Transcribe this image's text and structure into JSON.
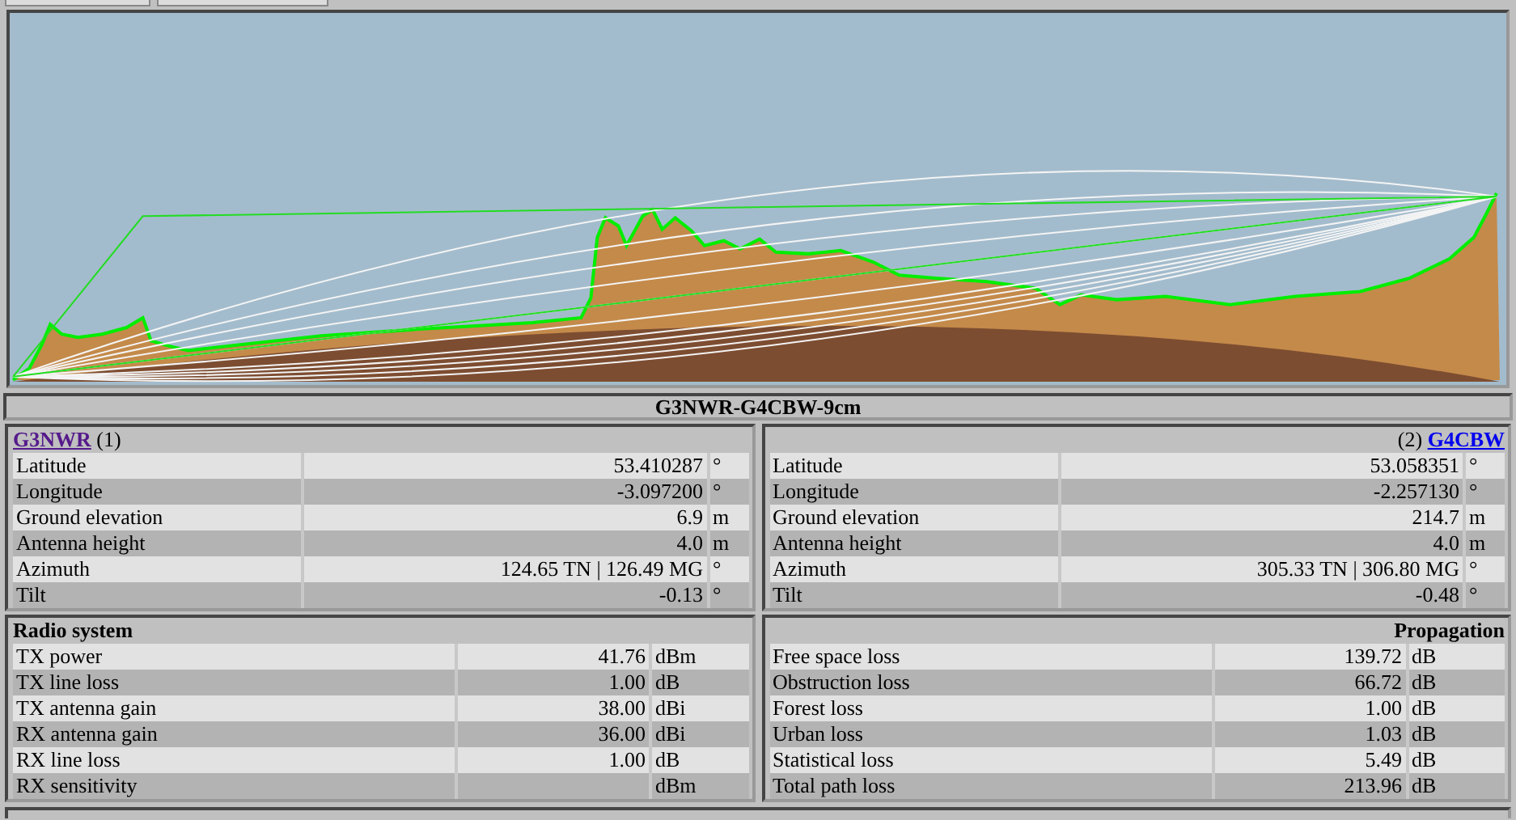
{
  "profile": {
    "title": "G3NWR-G4CBW-9cm"
  },
  "sites": [
    {
      "name": "G3NWR",
      "number": "(1)",
      "visited": true,
      "rows": [
        {
          "label": "Latitude",
          "value": "53.410287",
          "unit": "°"
        },
        {
          "label": "Longitude",
          "value": "-3.097200",
          "unit": "°"
        },
        {
          "label": "Ground elevation",
          "value": "6.9",
          "unit": "m"
        },
        {
          "label": "Antenna height",
          "value": "4.0",
          "unit": "m"
        },
        {
          "label": "Azimuth",
          "value": "124.65 TN | 126.49 MG",
          "unit": "°"
        },
        {
          "label": "Tilt",
          "value": "-0.13",
          "unit": "°"
        }
      ]
    },
    {
      "name": "G4CBW",
      "number": "(2)",
      "visited": false,
      "rows": [
        {
          "label": "Latitude",
          "value": "53.058351",
          "unit": "°"
        },
        {
          "label": "Longitude",
          "value": "-2.257130",
          "unit": "°"
        },
        {
          "label": "Ground elevation",
          "value": "214.7",
          "unit": "m"
        },
        {
          "label": "Antenna height",
          "value": "4.0",
          "unit": "m"
        },
        {
          "label": "Azimuth",
          "value": "305.33 TN | 306.80 MG",
          "unit": "°"
        },
        {
          "label": "Tilt",
          "value": "-0.48",
          "unit": "°"
        }
      ]
    }
  ],
  "panels": [
    {
      "title": "Radio system",
      "rows": [
        {
          "label": "TX power",
          "value": "41.76",
          "unit": "dBm"
        },
        {
          "label": "TX line loss",
          "value": "1.00",
          "unit": "dB"
        },
        {
          "label": "TX antenna gain",
          "value": "38.00",
          "unit": "dBi"
        },
        {
          "label": "RX antenna gain",
          "value": "36.00",
          "unit": "dBi"
        },
        {
          "label": "RX line loss",
          "value": "1.00",
          "unit": "dB"
        },
        {
          "label": "RX sensitivity",
          "unit": "dBm"
        }
      ]
    },
    {
      "title": "Propagation",
      "rows": [
        {
          "label": "Free space loss",
          "value": "139.72",
          "unit": "dB"
        },
        {
          "label": "Obstruction loss",
          "value": "66.72",
          "unit": "dB"
        },
        {
          "label": "Forest loss",
          "value": "1.00",
          "unit": "dB"
        },
        {
          "label": "Urban loss",
          "value": "1.03",
          "unit": "dB"
        },
        {
          "label": "Statistical loss",
          "value": "5.49",
          "unit": "dB"
        },
        {
          "label": "Total path loss",
          "value": "213.96",
          "unit": "dB"
        }
      ]
    }
  ]
}
